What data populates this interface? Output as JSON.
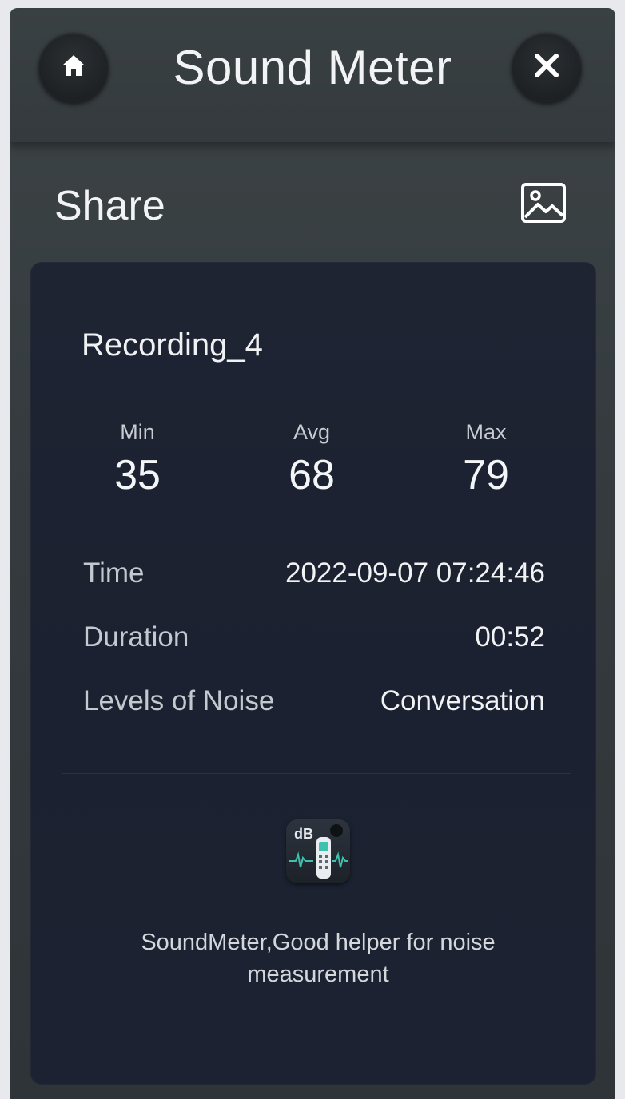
{
  "header": {
    "title": "Sound Meter",
    "home_icon": "home-icon",
    "close_icon": "close-icon"
  },
  "share": {
    "title": "Share",
    "image_icon": "image-icon"
  },
  "recording": {
    "name": "Recording_4",
    "stats": {
      "min_label": "Min",
      "min_value": "35",
      "avg_label": "Avg",
      "avg_value": "68",
      "max_label": "Max",
      "max_value": "79"
    },
    "details": [
      {
        "label": "Time",
        "value": "2022-09-07 07:24:46"
      },
      {
        "label": "Duration",
        "value": "00:52"
      },
      {
        "label": "Levels of Noise",
        "value": "Conversation"
      }
    ]
  },
  "footer": {
    "app_icon_text": "dB",
    "tagline": "SoundMeter,Good helper for noise measurement"
  },
  "colors": {
    "background": "#353b3e",
    "card": "#1d2331",
    "text": "#f2f3f4",
    "accent": "#3fc1b0"
  }
}
